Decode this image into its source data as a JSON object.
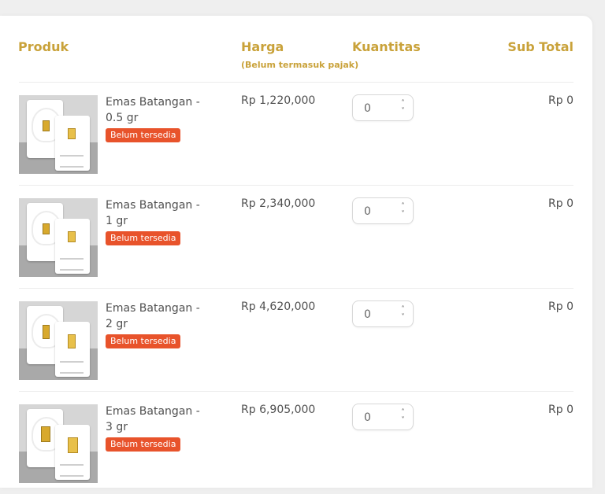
{
  "header": {
    "produk": "Produk",
    "harga": "Harga",
    "harga_note": "(Belum termasuk pajak)",
    "kuantitas": "Kuantitas",
    "sub_total": "Sub Total"
  },
  "colors": {
    "accent": "#c9a23a",
    "badge": "#e8532b"
  },
  "items": [
    {
      "name": "Emas Batangan - 0.5 gr",
      "badge": "Belum tersedia",
      "price": "Rp 1,220,000",
      "qty": "0",
      "subtotal": "Rp 0",
      "image_icon": "gold-bar-package-image"
    },
    {
      "name": "Emas Batangan - 1 gr",
      "badge": "Belum tersedia",
      "price": "Rp 2,340,000",
      "qty": "0",
      "subtotal": "Rp 0",
      "image_icon": "gold-bar-package-image"
    },
    {
      "name": "Emas Batangan - 2 gr",
      "badge": "Belum tersedia",
      "price": "Rp 4,620,000",
      "qty": "0",
      "subtotal": "Rp 0",
      "image_icon": "gold-bar-package-image"
    },
    {
      "name": "Emas Batangan - 3 gr",
      "badge": "Belum tersedia",
      "price": "Rp 6,905,000",
      "qty": "0",
      "subtotal": "Rp 0",
      "image_icon": "gold-bar-package-image"
    }
  ]
}
